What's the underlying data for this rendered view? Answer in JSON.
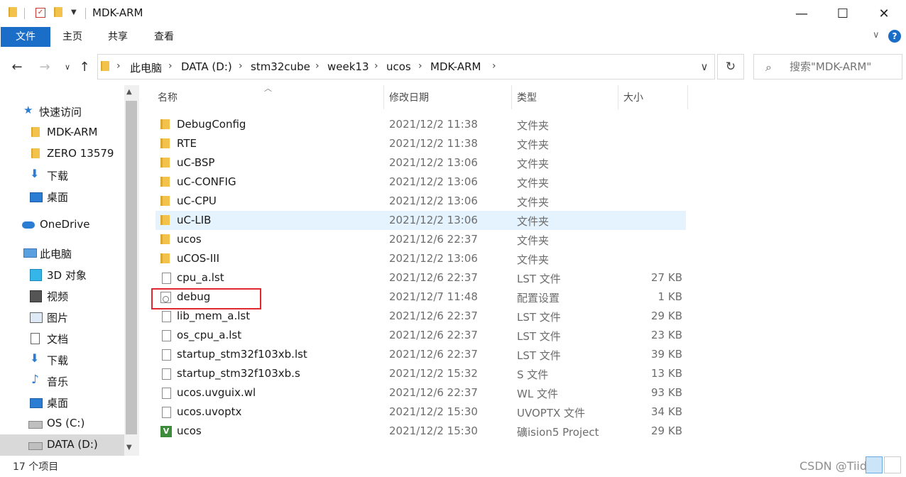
{
  "window": {
    "title": "MDK-ARM",
    "minimize": "—",
    "maximize": "☐",
    "close": "✕"
  },
  "ribbon": {
    "tabs": [
      "文件",
      "主页",
      "共享",
      "查看"
    ]
  },
  "address": {
    "crumbs": [
      "此电脑",
      "DATA (D:)",
      "stm32cube",
      "week13",
      "ucos",
      "MDK-ARM"
    ]
  },
  "search": {
    "placeholder": "搜索\"MDK-ARM\""
  },
  "nav": {
    "items": [
      {
        "label": "快速访问",
        "icon": "star-icon"
      },
      {
        "label": "MDK-ARM",
        "icon": "folder-icon"
      },
      {
        "label": "ZERO 13579",
        "icon": "folder-icon"
      },
      {
        "label": "下载",
        "icon": "download-icon"
      },
      {
        "label": "桌面",
        "icon": "desktop-icon"
      },
      {
        "label": "OneDrive",
        "icon": "cloud-icon"
      },
      {
        "label": "此电脑",
        "icon": "computer-icon"
      },
      {
        "label": "3D 对象",
        "icon": "cube-icon"
      },
      {
        "label": "视频",
        "icon": "video-icon"
      },
      {
        "label": "图片",
        "icon": "picture-icon"
      },
      {
        "label": "文档",
        "icon": "document-icon"
      },
      {
        "label": "下载",
        "icon": "download-icon"
      },
      {
        "label": "音乐",
        "icon": "music-icon"
      },
      {
        "label": "桌面",
        "icon": "desktop-icon"
      },
      {
        "label": "OS (C:)",
        "icon": "drive-icon"
      },
      {
        "label": "DATA (D:)",
        "icon": "drive-icon"
      }
    ]
  },
  "columns": {
    "name": "名称",
    "date": "修改日期",
    "type": "类型",
    "size": "大小"
  },
  "files": [
    {
      "name": "DebugConfig",
      "date": "2021/12/2 11:38",
      "type": "文件夹",
      "size": "",
      "icon": "folder-icon"
    },
    {
      "name": "RTE",
      "date": "2021/12/2 11:38",
      "type": "文件夹",
      "size": "",
      "icon": "folder-icon"
    },
    {
      "name": "uC-BSP",
      "date": "2021/12/2 13:06",
      "type": "文件夹",
      "size": "",
      "icon": "folder-icon"
    },
    {
      "name": "uC-CONFIG",
      "date": "2021/12/2 13:06",
      "type": "文件夹",
      "size": "",
      "icon": "folder-icon"
    },
    {
      "name": "uC-CPU",
      "date": "2021/12/2 13:06",
      "type": "文件夹",
      "size": "",
      "icon": "folder-icon"
    },
    {
      "name": "uC-LIB",
      "date": "2021/12/2 13:06",
      "type": "文件夹",
      "size": "",
      "icon": "folder-icon"
    },
    {
      "name": "ucos",
      "date": "2021/12/6 22:37",
      "type": "文件夹",
      "size": "",
      "icon": "folder-icon"
    },
    {
      "name": "uCOS-III",
      "date": "2021/12/2 13:06",
      "type": "文件夹",
      "size": "",
      "icon": "folder-icon"
    },
    {
      "name": "cpu_a.lst",
      "date": "2021/12/6 22:37",
      "type": "LST 文件",
      "size": "27 KB",
      "icon": "file-icon"
    },
    {
      "name": "debug",
      "date": "2021/12/7 11:48",
      "type": "配置设置",
      "size": "1 KB",
      "icon": "config-file-icon"
    },
    {
      "name": "lib_mem_a.lst",
      "date": "2021/12/6 22:37",
      "type": "LST 文件",
      "size": "29 KB",
      "icon": "file-icon"
    },
    {
      "name": "os_cpu_a.lst",
      "date": "2021/12/6 22:37",
      "type": "LST 文件",
      "size": "23 KB",
      "icon": "file-icon"
    },
    {
      "name": "startup_stm32f103xb.lst",
      "date": "2021/12/6 22:37",
      "type": "LST 文件",
      "size": "39 KB",
      "icon": "file-icon"
    },
    {
      "name": "startup_stm32f103xb.s",
      "date": "2021/12/2 15:32",
      "type": "S 文件",
      "size": "13 KB",
      "icon": "file-icon"
    },
    {
      "name": "ucos.uvguix.wl",
      "date": "2021/12/6 22:37",
      "type": "WL 文件",
      "size": "93 KB",
      "icon": "file-icon"
    },
    {
      "name": "ucos.uvoptx",
      "date": "2021/12/2 15:30",
      "type": "UVOPTX 文件",
      "size": "34 KB",
      "icon": "file-icon"
    },
    {
      "name": "ucos",
      "date": "2021/12/2 15:30",
      "type": "礦ision5 Project",
      "size": "29 KB",
      "icon": "uvision-icon"
    }
  ],
  "status": {
    "item_count": "17 个项目"
  },
  "watermark": "CSDN @Tiida",
  "colors": {
    "accent": "#1a6ec7",
    "selection": "#e5f3ff",
    "highlight_box": "#e0282e",
    "folder": "#f2c24b"
  }
}
